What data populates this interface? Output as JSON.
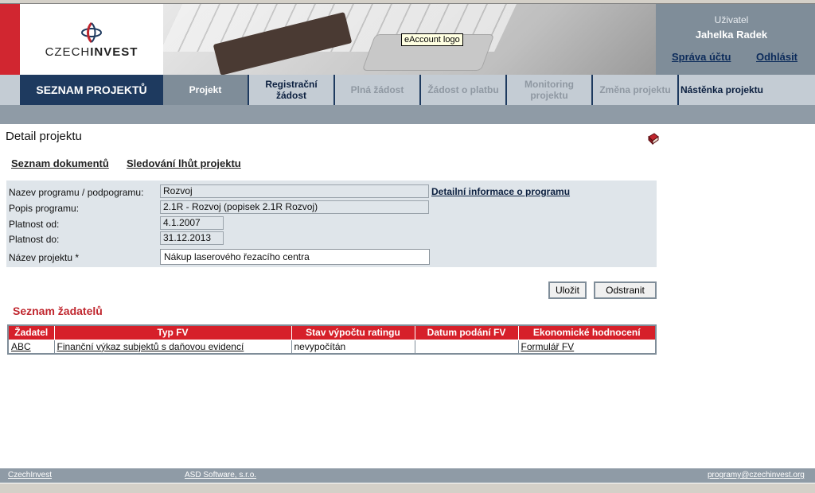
{
  "header": {
    "logo_text_light": "CZECH",
    "logo_text_bold": "INVEST",
    "tooltip": "eAccount logo",
    "user_label": "Uživatel",
    "user_name": "Jahelka Radek",
    "account_link": "Správa účtu",
    "logout_link": "Odhlásit"
  },
  "nav": {
    "main": "SEZNAM PROJEKTŮ",
    "tabs": [
      {
        "label": "Projekt",
        "state": "active"
      },
      {
        "label": "Registrační žádost",
        "state": "enabled"
      },
      {
        "label": "Plná žádost",
        "state": "disabled"
      },
      {
        "label": "Žádost o platbu",
        "state": "disabled"
      },
      {
        "label": "Monitoring projektu",
        "state": "disabled"
      },
      {
        "label": "Změna projektu",
        "state": "disabled"
      },
      {
        "label": "Nástěnka projektu",
        "state": "enabled"
      }
    ]
  },
  "page": {
    "title": "Detail projektu",
    "links": [
      "Seznam dokumentů",
      "Sledování lhůt projektu"
    ]
  },
  "form": {
    "program_label": "Nazev programu / podpogramu:",
    "program_value": "Rozvoj",
    "program_link": "Detailní informace o programu",
    "desc_label": "Popis programu:",
    "desc_value": "2.1R - Rozvoj (popisek 2.1R Rozvoj)",
    "from_label": "Platnost od:",
    "from_value": "4.1.2007",
    "to_label": "Platnost do:",
    "to_value": "31.12.2013",
    "name_label": "Název projektu *",
    "name_value": "Nákup laserového řezacího centra"
  },
  "buttons": {
    "save": "Uložit",
    "remove": "Odstranit"
  },
  "applicants": {
    "title": "Seznam žadatelů",
    "columns": [
      "Žadatel",
      "Typ FV",
      "Stav výpočtu ratingu",
      "Datum podání FV",
      "Ekonomické hodnocení"
    ],
    "rows": [
      [
        "ABC",
        "Finanční výkaz subjektů s daňovou evidencí",
        "nevypočítán",
        "",
        "Formulář FV"
      ]
    ]
  },
  "footer": {
    "left": "CzechInvest",
    "middle": "ASD Software, s.r.o.",
    "right": "programy@czechinvest.org"
  },
  "colors": {
    "brand_red": "#d12630",
    "nav_dark": "#1e3a5f",
    "panel": "#dfe5ea"
  }
}
